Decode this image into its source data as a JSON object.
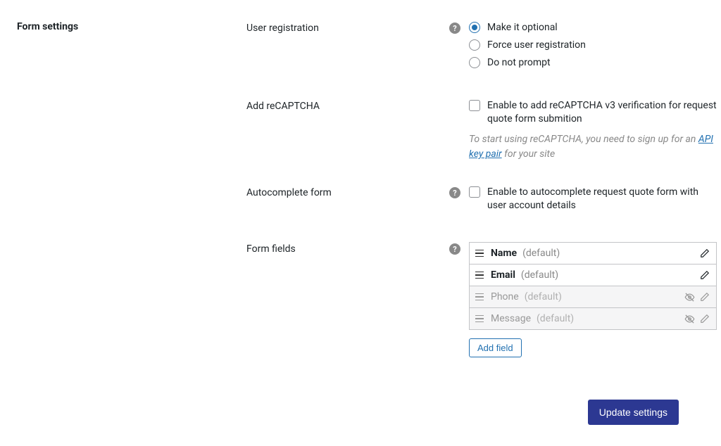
{
  "section": {
    "title": "Form settings"
  },
  "user_registration": {
    "label": "User registration",
    "options": {
      "optional": "Make it optional",
      "force": "Force user registration",
      "none": "Do not prompt"
    }
  },
  "recaptcha": {
    "label": "Add reCAPTCHA",
    "checkbox_label": "Enable to add reCAPTCHA v3 verification for request quote form submition",
    "hint_prefix": "To start using reCAPTCHA, you need to sign up for an ",
    "hint_link": "API key pair",
    "hint_suffix": " for your site"
  },
  "autocomplete": {
    "label": "Autocomplete form",
    "checkbox_label": "Enable to autocomplete request quote form with user account details"
  },
  "form_fields": {
    "label": "Form fields",
    "add_button": "Add field",
    "default_suffix": "(default)",
    "items": [
      {
        "name": "Name",
        "enabled": true
      },
      {
        "name": "Email",
        "enabled": true
      },
      {
        "name": "Phone",
        "enabled": false
      },
      {
        "name": "Message",
        "enabled": false
      }
    ]
  },
  "footer": {
    "submit": "Update settings"
  },
  "glyphs": {
    "help": "?"
  }
}
